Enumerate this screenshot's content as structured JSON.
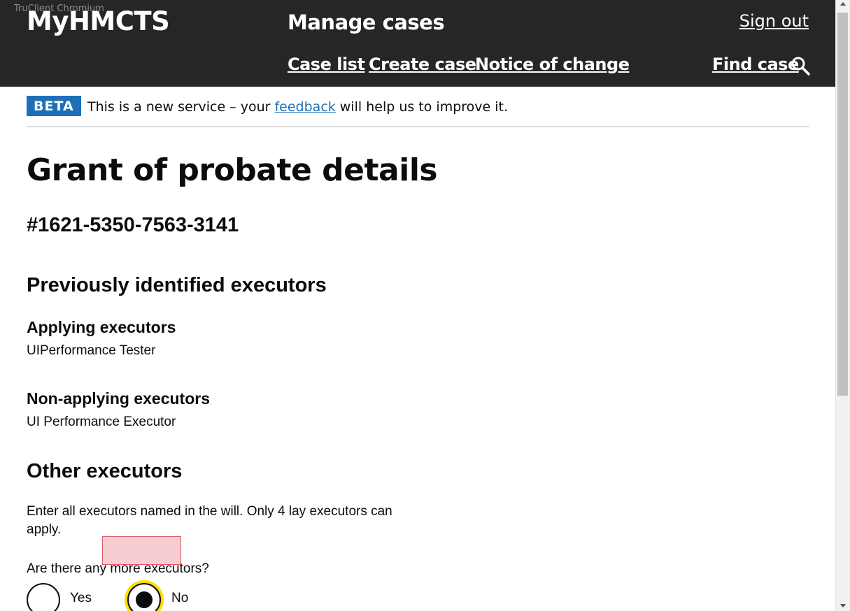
{
  "watermark": "TruClient Chromium",
  "header": {
    "brand": "MyHMCTS",
    "service": "Manage cases",
    "sign_out": "Sign out",
    "nav": {
      "case_list": "Case list",
      "create_case": "Create case",
      "notice_of_change": "Notice of change",
      "find_case": "Find case"
    }
  },
  "phase_banner": {
    "tag": "BETA",
    "text_before": "This is a new service – your ",
    "link": "feedback",
    "text_after": " will help us to improve it."
  },
  "page": {
    "title": "Grant of probate details",
    "case_reference": "#1621-5350-7563-3141",
    "previous_heading": "Previously identified executors",
    "applying_heading": "Applying executors",
    "applying_value": "UIPerformance Tester",
    "non_applying_heading": "Non-applying executors",
    "non_applying_value": "UI Performance Executor",
    "other_heading": "Other executors",
    "hint": "Enter all executors named in the will. Only 4 lay executors can apply.",
    "question": "Are there any more executors?",
    "options": {
      "yes": "Yes",
      "no": "No"
    },
    "selected": "No"
  },
  "colors": {
    "header_bg": "#262626",
    "beta_tag": "#1d70b8",
    "link": "#1d70b8",
    "focus": "#ffdd00",
    "overlay": "#f2c9cd"
  }
}
